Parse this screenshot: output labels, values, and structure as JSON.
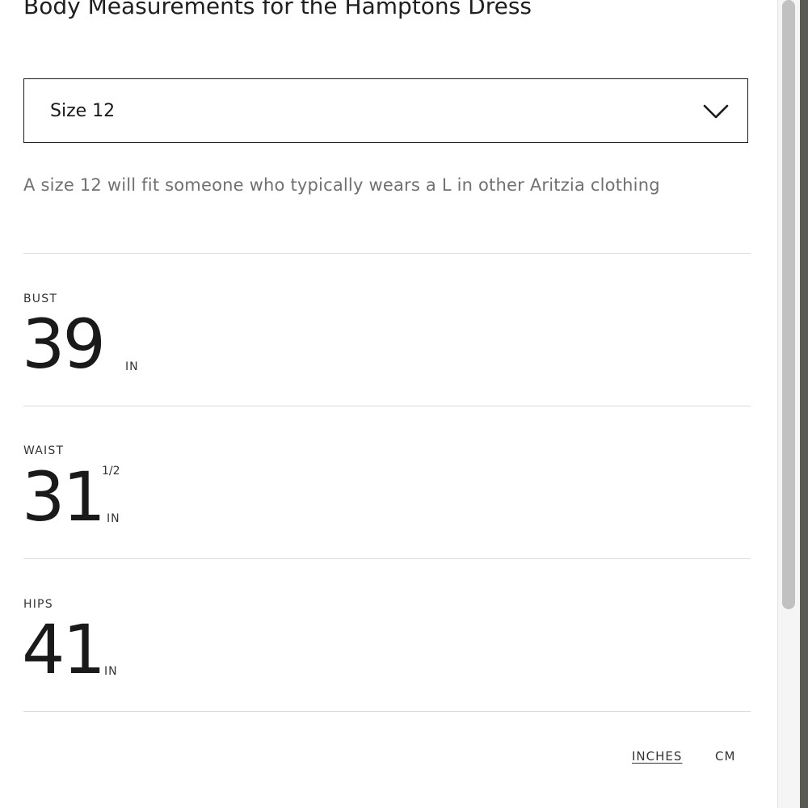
{
  "title": "Body Measurements for the Hamptons Dress",
  "size_select": {
    "selected": "Size 12"
  },
  "fit_note": "A size 12 will fit someone who typically wears a L in other Aritzia clothing",
  "measurements": {
    "bust": {
      "label": "BUST",
      "value": "39",
      "fraction": "",
      "unit": "IN"
    },
    "waist": {
      "label": "WAIST",
      "value": "31",
      "fraction": "1/2",
      "unit": "IN"
    },
    "hips": {
      "label": "HIPS",
      "value": "41",
      "fraction": "",
      "unit": "IN"
    }
  },
  "units": {
    "inches": "INCHES",
    "cm": "CM",
    "active": "inches"
  },
  "icons": {
    "dropdown": "chevron-down-icon"
  }
}
